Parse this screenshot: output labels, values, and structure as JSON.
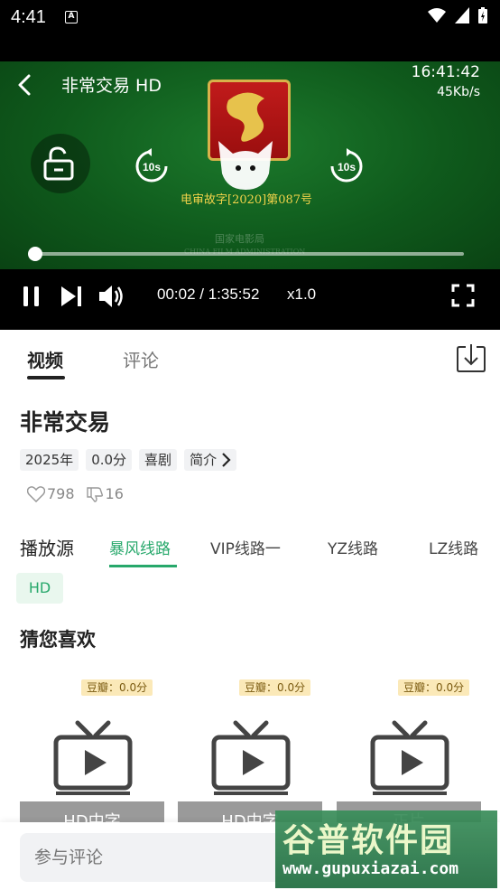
{
  "status_bar": {
    "time": "4:41",
    "notification_letter": "A"
  },
  "player": {
    "title": "非常交易 HD",
    "clock": "16:41:42",
    "net_speed": "45Kb/s",
    "rewind_label": "10s",
    "forward_label": "10s",
    "certificate": "电审故字[2020]第087号",
    "bureau_cn": "国家电影局",
    "bureau_en": "CHINA FILM ADMINISTRATION",
    "progress_fraction": 0.0004,
    "time_display": "00:02 / 1:35:52",
    "playback_rate": "x1.0"
  },
  "tabs": [
    {
      "label": "视频",
      "active": true
    },
    {
      "label": "评论",
      "active": false
    }
  ],
  "movie": {
    "title": "非常交易",
    "tags": [
      "2025年",
      "0.0分",
      "喜剧"
    ],
    "intro_label": "简介",
    "likes": "798",
    "dislikes": "16"
  },
  "sources": {
    "label": "播放源",
    "items": [
      "暴风线路",
      "VIP线路一",
      "YZ线路",
      "LZ线路"
    ],
    "active_index": 0,
    "episode": "HD"
  },
  "recommend": {
    "heading": "猜您喜欢",
    "cards": [
      {
        "badge": "豆瓣：0.0分",
        "caption": "HD中字"
      },
      {
        "badge": "豆瓣：0.0分",
        "caption": "HD中字"
      },
      {
        "badge": "豆瓣：0.0分",
        "caption": "正片"
      }
    ]
  },
  "comment": {
    "placeholder": "参与评论"
  },
  "watermark": {
    "cn": "谷普软件园",
    "en": "www.gupuxiazai.com"
  },
  "colors": {
    "accent": "#27a86b",
    "player_bg": "#0f5a1c"
  }
}
